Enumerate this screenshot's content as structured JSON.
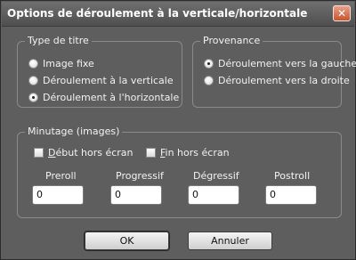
{
  "dialog": {
    "title": "Options de déroulement à la verticale/horizontale",
    "close_glyph": "✕"
  },
  "type_group": {
    "legend": "Type de titre",
    "options": [
      {
        "label": "Image fixe",
        "checked": false
      },
      {
        "label": "Déroulement à la verticale",
        "checked": false
      },
      {
        "label": "Déroulement à l'horizontale",
        "checked": true
      }
    ]
  },
  "source_group": {
    "legend": "Provenance",
    "options": [
      {
        "label": "Déroulement vers la gauche",
        "checked": true
      },
      {
        "label": "Déroulement vers la droite",
        "checked": false
      }
    ]
  },
  "timing_group": {
    "legend": "Minutage (images)",
    "start_offscreen": {
      "u": "D",
      "rest": "ébut hors écran",
      "checked": false
    },
    "end_offscreen": {
      "u": "F",
      "rest": "in hors écran",
      "checked": false
    },
    "fields": [
      {
        "label": "Preroll",
        "value": "0"
      },
      {
        "label": "Progressif",
        "value": "0"
      },
      {
        "label": "Dégressif",
        "value": "0"
      },
      {
        "label": "Postroll",
        "value": "0"
      }
    ]
  },
  "buttons": {
    "ok": "OK",
    "cancel": "Annuler"
  }
}
